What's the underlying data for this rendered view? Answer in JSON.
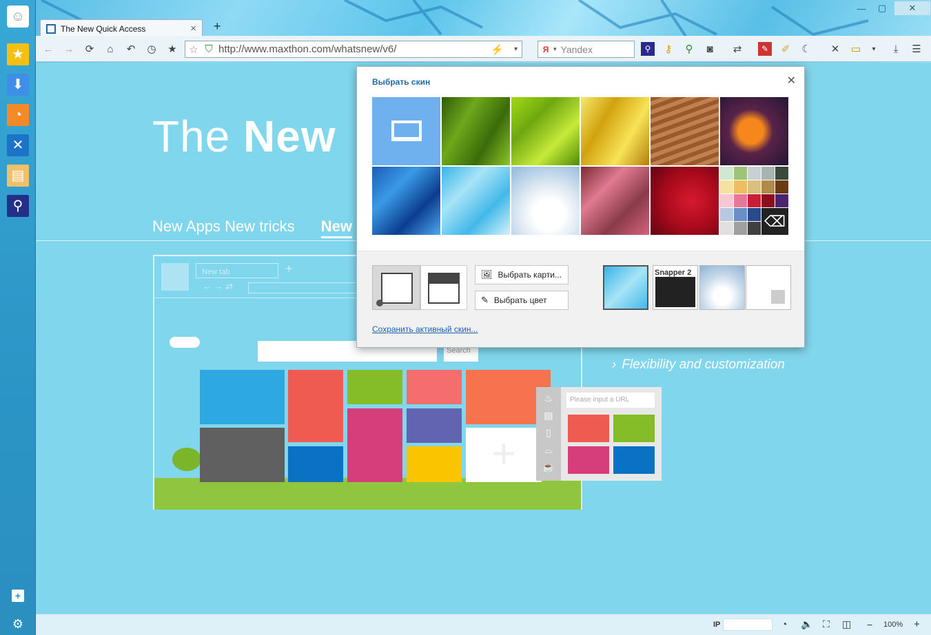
{
  "window": {
    "tab_title": "The New Quick Access",
    "new_tab_symbol": "+",
    "tab_close": "×"
  },
  "toolbar": {
    "url": "http://www.maxthon.com/whatsnew/v6/",
    "search_engine": "Yandex"
  },
  "page": {
    "hero_title_light": "The",
    "hero_title_bold": "New",
    "nav_item_1": "New Apps New tricks",
    "nav_item_2": "New",
    "flex_text": "Flexibility and customization",
    "mock_tab_label": "New tab",
    "mock_search_button": "Search",
    "mock_url_placeholder": "Please input a URL"
  },
  "skin_popup": {
    "title": "Выбрать скин",
    "choose_picture_button": "Выбрать карти...",
    "choose_color_button": "Выбрать цвет",
    "save_skin_link": "Сохранить активный скин...",
    "thumb_label": "Snapper 2"
  },
  "statusbar": {
    "ip_label": "IP",
    "zoom": "100%",
    "zoom_minus": "−",
    "zoom_plus": "+"
  },
  "colors": {
    "accent": "#1f6aa6",
    "page_bg": "#80d6ec",
    "tile_blue": "#2ea8e0",
    "tile_red": "#ef5b50",
    "tile_green": "#84bd27",
    "tile_pink": "#f46e6e",
    "tile_orange": "#f7734d",
    "tile_gray": "#606060",
    "tile_darkblue": "#0a72c2",
    "tile_magenta": "#d63e7a",
    "tile_purple": "#6264b2",
    "tile_yellow": "#fac400"
  },
  "icons": {
    "sidebar": [
      "smiley-icon",
      "favorites-star-icon",
      "download-icon",
      "rss-icon",
      "tools-icon",
      "notes-icon",
      "magnifier-icon",
      "add-icon",
      "settings-gear-icon"
    ]
  }
}
